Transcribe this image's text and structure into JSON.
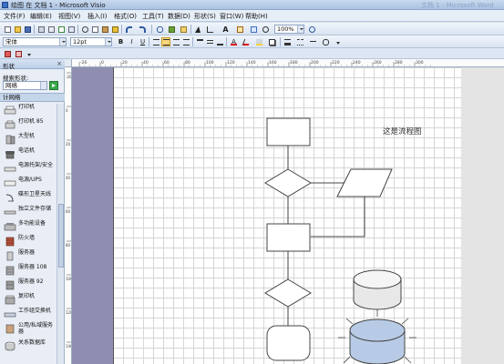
{
  "window": {
    "title": "绘图 在 文档 1 - Microsoft Visio",
    "ghost_title": "文档 1 - Microsoft Word"
  },
  "menu": {
    "items": [
      "文件(F)",
      "编辑(E)",
      "视图(V)",
      "插入(I)",
      "格式(O)",
      "工具(T)",
      "数据(D)",
      "形状(S)",
      "窗口(W)",
      "帮助(H)"
    ]
  },
  "toolbar": {
    "zoom": "100%"
  },
  "format_toolbar": {
    "font": "宋体",
    "size": "12pt"
  },
  "shapes_panel": {
    "title": "形状",
    "search_label": "搜索形状:",
    "search_scope": "网络",
    "stencil_title": "计网络",
    "items": [
      "打印机",
      "打印机 85",
      "大型机",
      "电话机",
      "电源托架/安全",
      "电源/UPS",
      "碟形卫星天线",
      "独立文件存储",
      "多功能设备",
      "防火墙",
      "服务器",
      "服务器 108",
      "服务器 92",
      "复印机",
      "工作组交换机",
      "公用/私域服务器",
      "关系数据库"
    ]
  },
  "ruler": {
    "h_ticks": [
      "-20",
      "0",
      "20",
      "40",
      "60",
      "80",
      "100",
      "120",
      "140",
      "160",
      "180",
      "200",
      "220",
      "240",
      "260",
      "280",
      "300"
    ],
    "v_ticks": [
      "-20",
      "0",
      "20",
      "40",
      "60",
      "80",
      "100",
      "120",
      "140"
    ]
  },
  "canvas": {
    "label": "这是流程图"
  },
  "colors": {
    "accent": "#3b6fc1",
    "db_fill": "#b8cbe6"
  }
}
